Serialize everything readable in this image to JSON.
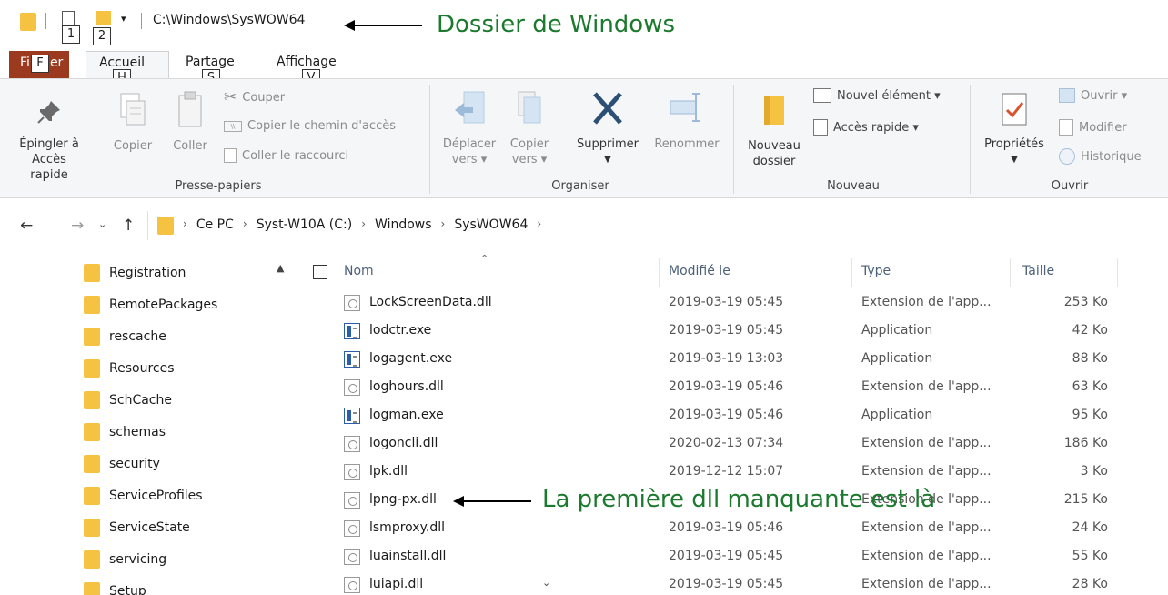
{
  "titlebar": {
    "path": "C:\\Windows\\SysWOW64",
    "qat_key1": "1",
    "qat_key2": "2",
    "qat_menu": "▾"
  },
  "annotations": {
    "top": "Dossier de Windows",
    "row": "La première dll manquante est là"
  },
  "tabs": {
    "file_label": "Fi",
    "file_tail": "er",
    "file_keytip": "F",
    "items": [
      {
        "label": "Accueil",
        "keytip": "H"
      },
      {
        "label": "Partage",
        "keytip": "S"
      },
      {
        "label": "Affichage",
        "keytip": "V"
      }
    ]
  },
  "ribbon": {
    "clipboard": {
      "pin_line1": "Épingler à",
      "pin_line2": "Accès rapide",
      "copy": "Copier",
      "paste": "Coller",
      "cut": "Couper",
      "copy_path": "Copier le chemin d'accès",
      "paste_shortcut": "Coller le raccourci",
      "label": "Presse-papiers"
    },
    "organize": {
      "move_line1": "Déplacer",
      "move_line2": "vers ▾",
      "copyto_line1": "Copier",
      "copyto_line2": "vers ▾",
      "delete": "Supprimer",
      "rename": "Renommer",
      "label": "Organiser"
    },
    "new": {
      "new_folder_line1": "Nouveau",
      "new_folder_line2": "dossier",
      "new_item": "Nouvel élément ▾",
      "quick_access": "Accès rapide ▾",
      "label": "Nouveau"
    },
    "open": {
      "properties": "Propriétés",
      "open": "Ouvrir ▾",
      "edit": "Modifier",
      "history": "Historique",
      "label": "Ouvrir"
    }
  },
  "address": {
    "crumbs": [
      "Ce PC",
      "Syst-W10A (C:)",
      "Windows",
      "SysWOW64"
    ]
  },
  "navpane": {
    "items": [
      "Registration",
      "RemotePackages",
      "rescache",
      "Resources",
      "SchCache",
      "schemas",
      "security",
      "ServiceProfiles",
      "ServiceState",
      "servicing",
      "Setup"
    ]
  },
  "filelist": {
    "columns": {
      "name": "Nom",
      "modified": "Modifié le",
      "type": "Type",
      "size": "Taille"
    },
    "rows": [
      {
        "name": "LockScreenData.dll",
        "modified": "2019-03-19 05:45",
        "type": "Extension de l'app...",
        "size": "253 Ko",
        "icon": "dll"
      },
      {
        "name": "lodctr.exe",
        "modified": "2019-03-19 05:45",
        "type": "Application",
        "size": "42 Ko",
        "icon": "exe"
      },
      {
        "name": "logagent.exe",
        "modified": "2019-03-19 13:03",
        "type": "Application",
        "size": "88 Ko",
        "icon": "exe"
      },
      {
        "name": "loghours.dll",
        "modified": "2019-03-19 05:46",
        "type": "Extension de l'app...",
        "size": "63 Ko",
        "icon": "dll"
      },
      {
        "name": "logman.exe",
        "modified": "2019-03-19 05:46",
        "type": "Application",
        "size": "95 Ko",
        "icon": "exe"
      },
      {
        "name": "logoncli.dll",
        "modified": "2020-02-13 07:34",
        "type": "Extension de l'app...",
        "size": "186 Ko",
        "icon": "dll"
      },
      {
        "name": "lpk.dll",
        "modified": "2019-12-12 15:07",
        "type": "Extension de l'app...",
        "size": "3 Ko",
        "icon": "dll"
      },
      {
        "name": "lpng-px.dll",
        "modified": "",
        "type": "Extension de l'app...",
        "size": "215 Ko",
        "icon": "dll"
      },
      {
        "name": "lsmproxy.dll",
        "modified": "2019-03-19 05:46",
        "type": "Extension de l'app...",
        "size": "24 Ko",
        "icon": "dll"
      },
      {
        "name": "luainstall.dll",
        "modified": "2019-03-19 05:45",
        "type": "Extension de l'app...",
        "size": "55 Ko",
        "icon": "dll"
      },
      {
        "name": "luiapi.dll",
        "modified": "2019-03-19 05:45",
        "type": "Extension de l'app...",
        "size": "28 Ko",
        "icon": "dll"
      }
    ]
  },
  "colors": {
    "file_tab": "#9b3a1e",
    "annotation": "#1c7a2e",
    "folder": "#f5c242",
    "ribbon_bg": "#f5f6f7"
  }
}
